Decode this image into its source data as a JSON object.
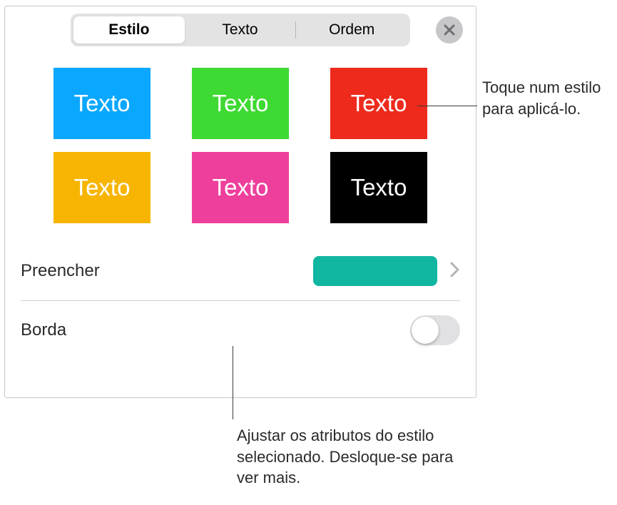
{
  "tabs": {
    "estilo": "Estilo",
    "texto": "Texto",
    "ordem": "Ordem"
  },
  "swatch_label": "Texto",
  "swatches": [
    {
      "color": "#0aa7ff"
    },
    {
      "color": "#3ed932"
    },
    {
      "color": "#ed2a1c"
    },
    {
      "color": "#f7b502"
    },
    {
      "color": "#ee3f9c"
    },
    {
      "color": "#000000"
    }
  ],
  "fill": {
    "label": "Preencher",
    "color": "#11b6a0"
  },
  "border": {
    "label": "Borda",
    "enabled": false
  },
  "callouts": {
    "right": "Toque num estilo para aplicá-lo.",
    "bottom": "Ajustar os atributos do estilo selecionado. Desloque-se para ver mais."
  }
}
